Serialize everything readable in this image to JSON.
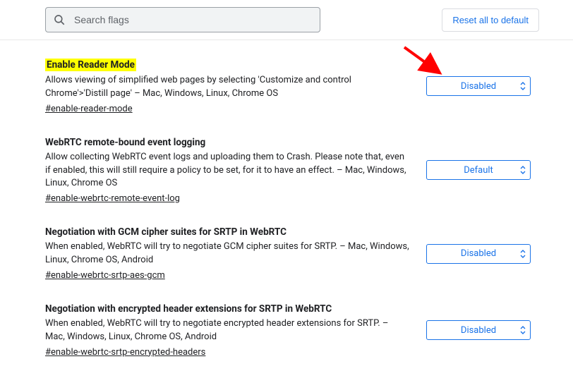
{
  "header": {
    "search_placeholder": "Search flags",
    "reset_label": "Reset all to default"
  },
  "flags": [
    {
      "title": "Enable Reader Mode",
      "desc": "Allows viewing of simplified web pages by selecting 'Customize and control Chrome'>'Distill page' – Mac, Windows, Linux, Chrome OS",
      "hash": "#enable-reader-mode",
      "value": "Disabled",
      "highlighted": true
    },
    {
      "title": "WebRTC remote-bound event logging",
      "desc": "Allow collecting WebRTC event logs and uploading them to Crash. Please note that, even if enabled, this will still require a policy to be set, for it to have an effect. – Mac, Windows, Linux, Chrome OS",
      "hash": "#enable-webrtc-remote-event-log",
      "value": "Default",
      "highlighted": false
    },
    {
      "title": "Negotiation with GCM cipher suites for SRTP in WebRTC",
      "desc": "When enabled, WebRTC will try to negotiate GCM cipher suites for SRTP. – Mac, Windows, Linux, Chrome OS, Android",
      "hash": "#enable-webrtc-srtp-aes-gcm",
      "value": "Disabled",
      "highlighted": false
    },
    {
      "title": "Negotiation with encrypted header extensions for SRTP in WebRTC",
      "desc": "When enabled, WebRTC will try to negotiate encrypted header extensions for SRTP. – Mac, Windows, Linux, Chrome OS, Android",
      "hash": "#enable-webrtc-srtp-encrypted-headers",
      "value": "Disabled",
      "highlighted": false
    }
  ],
  "colors": {
    "accent": "#1a73e8",
    "highlight": "#ffff00",
    "arrow": "#ff0000"
  }
}
